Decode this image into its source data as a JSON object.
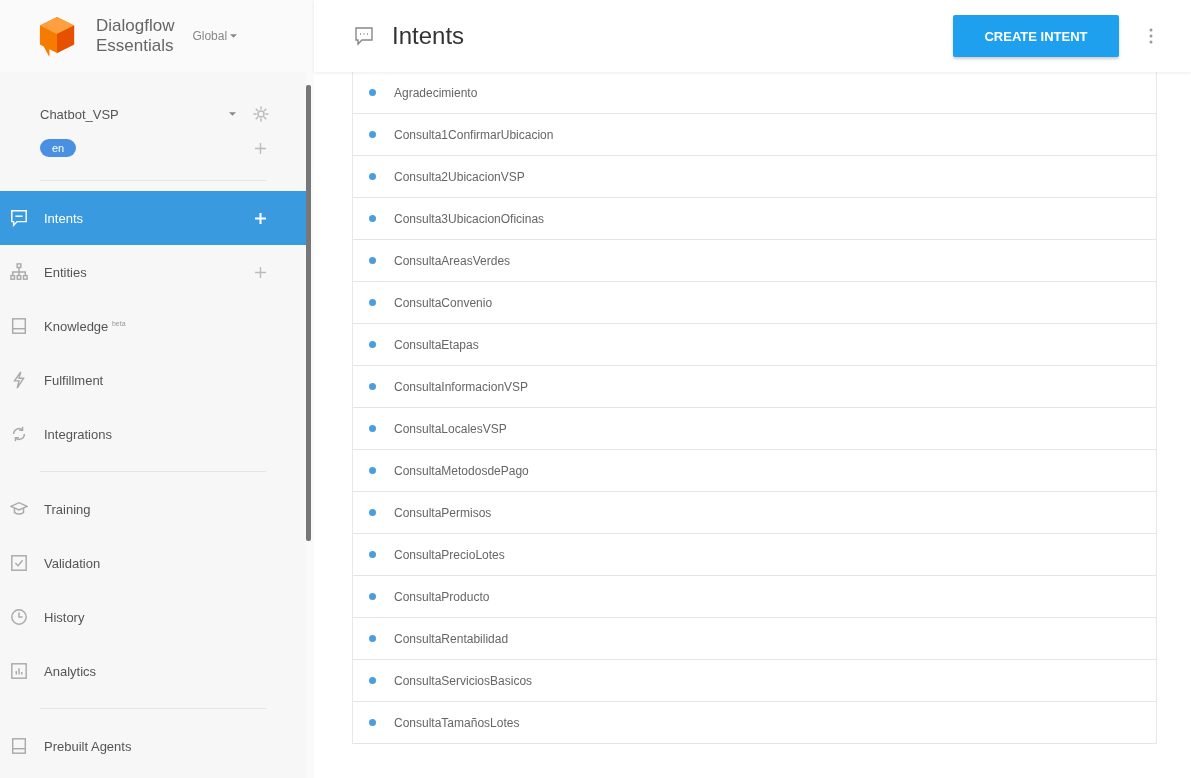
{
  "sidebar": {
    "logo": [
      "Dialogflow",
      "Essentials"
    ],
    "region": "Global",
    "agent": "Chatbot_VSP",
    "language": "en",
    "nav_groups": [
      [
        {
          "label": "Intents",
          "selected": true,
          "add": true
        },
        {
          "label": "Entities",
          "selected": false,
          "add": true
        },
        {
          "label": "Knowledge $^{beta}$",
          "selected": false,
          "add": false
        },
        {
          "label": "Fulfillment",
          "selected": false,
          "add": false
        },
        {
          "label": "Integrations",
          "selected": false,
          "add": false
        }
      ],
      [
        {
          "label": "Training",
          "selected": false,
          "add": false
        },
        {
          "label": "Validation",
          "selected": false,
          "add": false
        },
        {
          "label": "History",
          "selected": false,
          "add": false
        },
        {
          "label": "Analytics",
          "selected": false,
          "add": false
        }
      ],
      [
        {
          "label": "Prebuilt Agents",
          "selected": false,
          "add": false
        }
      ]
    ]
  },
  "header": {
    "title": "Intents",
    "button": "CREATE INTENT"
  },
  "intents": [
    {
      "name": "Agradecimiento"
    },
    {
      "name": "Consulta1ConfirmarUbicacion"
    },
    {
      "name": "Consulta2UbicacionVSP"
    },
    {
      "name": "Consulta3UbicacionOficinas"
    },
    {
      "name": "ConsultaAreasVerdes"
    },
    {
      "name": "ConsultaConvenio"
    },
    {
      "name": "ConsultaEtapas"
    },
    {
      "name": "ConsultaInformacionVSP"
    },
    {
      "name": "ConsultaLocalesVSP"
    },
    {
      "name": "ConsultaMetodosdePago"
    },
    {
      "name": "ConsultaPermisos"
    },
    {
      "name": "ConsultaPrecioLotes"
    },
    {
      "name": "ConsultaProducto"
    },
    {
      "name": "ConsultaRentabilidad"
    },
    {
      "name": "ConsultaServiciosBasicos"
    },
    {
      "name": "ConsultaTamañosLotes"
    }
  ]
}
